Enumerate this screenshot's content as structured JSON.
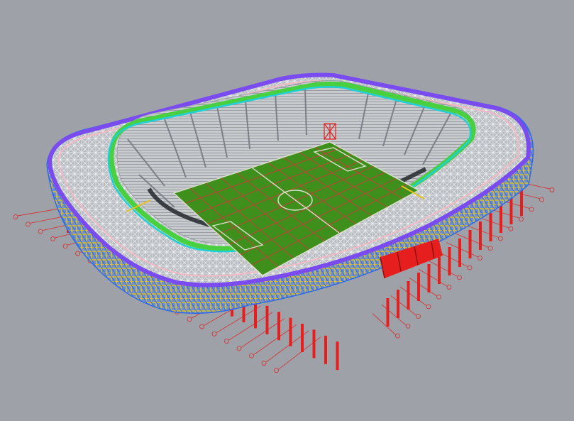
{
  "viewport": {
    "background": "#9ea2a8"
  },
  "model": {
    "subject": "stadium-structural-wireframe",
    "palette": {
      "pitch": "#3f8f1d",
      "pitch_lines": "#d7e0c8",
      "grid_lines": "#d23a3a",
      "columns": "#e61e1e",
      "roof_outer_ring": "#7a4cf0",
      "roof_inner_ring_cyan": "#21d0d6",
      "roof_inner_ring_green": "#48d040",
      "facade_yellow": "#e5c21c",
      "facade_blue": "#2e6ae8",
      "seating": "#c9cccf",
      "roof_truss": "#eef0f2"
    }
  }
}
